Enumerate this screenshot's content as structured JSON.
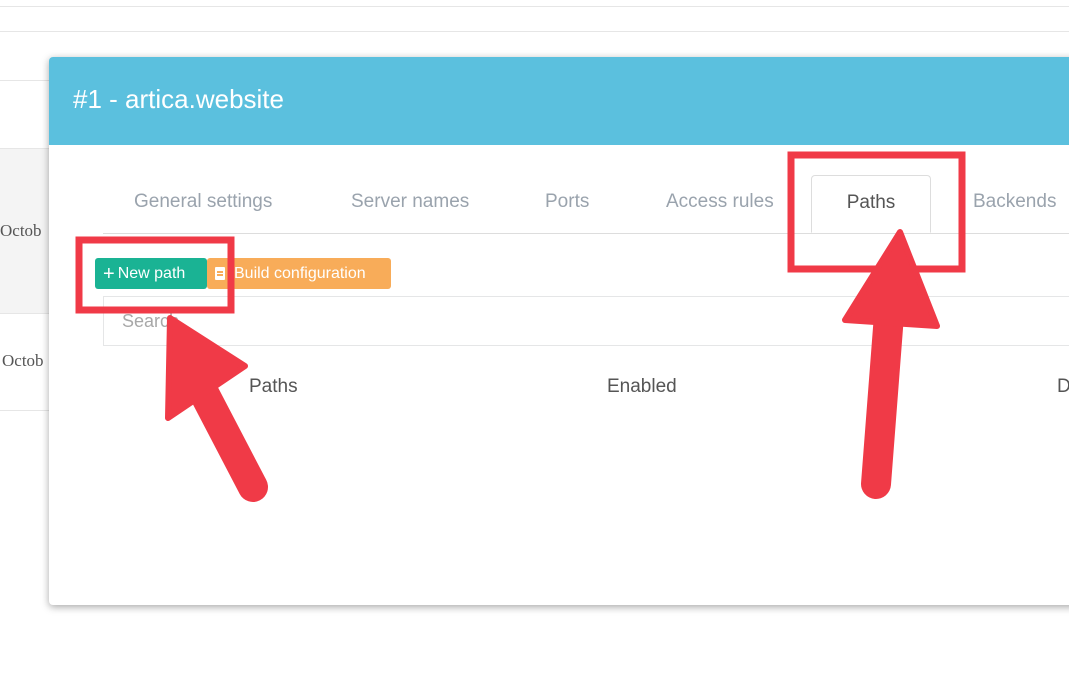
{
  "background": {
    "rows": [
      {
        "cell_text": "Octob"
      },
      {
        "cell_text": "Octob"
      }
    ]
  },
  "modal": {
    "title": "#1 - artica.website",
    "tabs": [
      {
        "label": "General settings"
      },
      {
        "label": "Server names"
      },
      {
        "label": "Ports"
      },
      {
        "label": "Access rules"
      },
      {
        "label": "Paths",
        "active": true
      },
      {
        "label": "Backends"
      }
    ],
    "toolbar": {
      "new_path_label": "New path",
      "build_config_label": "Build configuration"
    },
    "search": {
      "placeholder": "Search"
    },
    "table": {
      "columns": [
        "Paths",
        "Enabled",
        "D"
      ]
    }
  },
  "colors": {
    "header": "#5bc0de",
    "new_button": "#1ab394",
    "build_button": "#f8ac59",
    "annotation": "#f03a47"
  },
  "icons": {
    "new_path": "plus-icon",
    "build_configuration": "document-icon"
  }
}
